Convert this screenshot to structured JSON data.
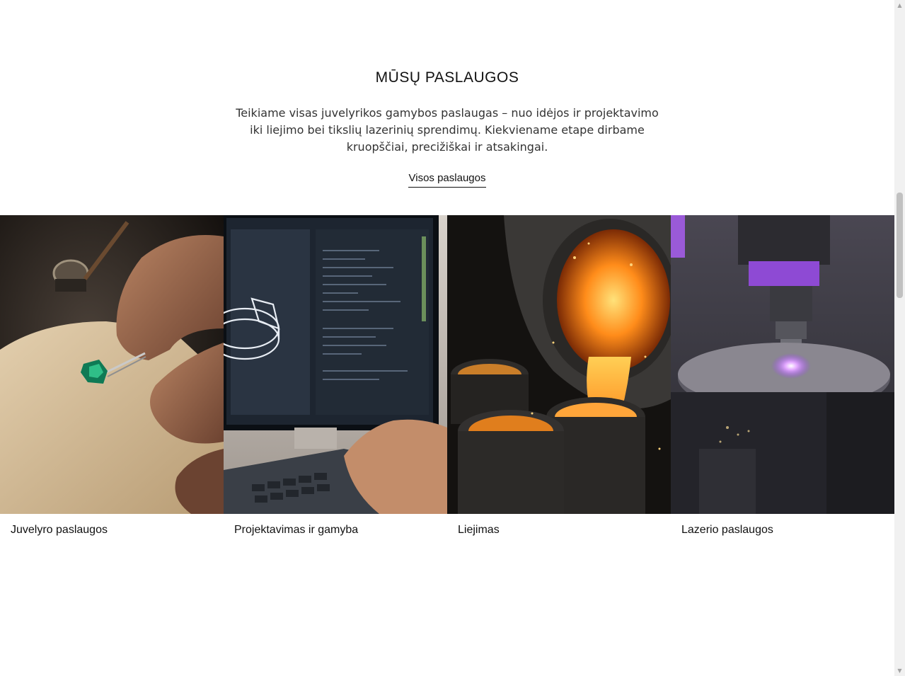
{
  "section": {
    "title": "MŪSŲ PASLAUGOS",
    "lead": "Teikiame visas juvelyrikos gamybos paslaugas – nuo idėjos ir projektavimo iki liejimo bei tikslių lazerinių sprendimų. Kiekviename etape dirbame kruopščiai, precižiškai ir atsakingai.",
    "all_link": "Visos paslaugos"
  },
  "services": [
    {
      "label": "Juvelyro paslaugos",
      "image": "jeweler-hands-emerald-photo"
    },
    {
      "label": "Projektavimas ir gamyba",
      "image": "cad-ring-monitor-photo"
    },
    {
      "label": "Liejimas",
      "image": "molten-metal-pouring-photo"
    },
    {
      "label": "Lazerio paslaugos",
      "image": "laser-engraving-machine-photo"
    }
  ],
  "colors": {
    "text": "#111111",
    "lead_text": "#333333",
    "scrollbar_track": "#f1f1f1",
    "scrollbar_thumb": "#c1c1c1"
  }
}
